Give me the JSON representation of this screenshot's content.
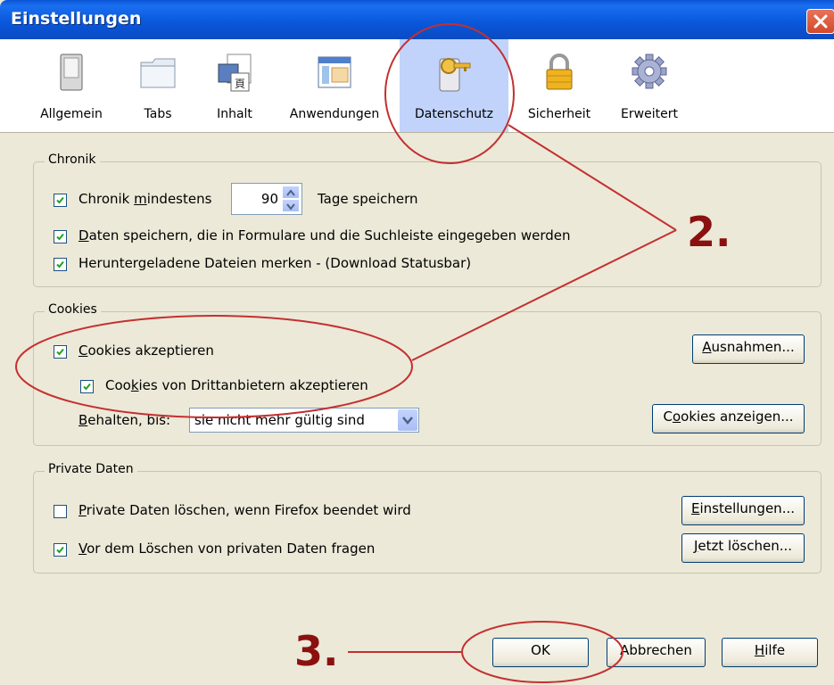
{
  "window": {
    "title": "Einstellungen"
  },
  "toolbar": {
    "items": [
      {
        "label": "Allgemein",
        "icon": "general-switch-icon"
      },
      {
        "label": "Tabs",
        "icon": "tabs-folder-icon"
      },
      {
        "label": "Inhalt",
        "icon": "content-page-icon"
      },
      {
        "label": "Anwendungen",
        "icon": "applications-window-icon"
      },
      {
        "label": "Datenschutz",
        "icon": "privacy-key-icon",
        "selected": true
      },
      {
        "label": "Sicherheit",
        "icon": "padlock-icon"
      },
      {
        "label": "Erweitert",
        "icon": "gear-icon"
      }
    ]
  },
  "history": {
    "legend": "Chronik",
    "keep_prefix": "Chronik ",
    "keep_access": "m",
    "keep_mid": "indestens",
    "days_value": "90",
    "days_suffix": "Tage speichern",
    "form_access": "D",
    "form_rest": "aten speichern, die in Formulare und die Suchleiste eingegeben werden",
    "downloads": "Heruntergeladene Dateien merken - (Download Statusbar)"
  },
  "cookies": {
    "legend": "Cookies",
    "accept_access": "C",
    "accept_rest": "ookies akzeptieren",
    "third_a": "Coo",
    "third_access": "k",
    "third_b": "ies von Drittanbietern akzeptieren",
    "keep_access": "B",
    "keep_rest": "ehalten, bis:",
    "keep_value": "sie nicht mehr gültig sind",
    "exceptions_access": "A",
    "exceptions_rest": "usnahmen...",
    "show_a": "C",
    "show_access": "o",
    "show_b": "okies anzeigen..."
  },
  "private": {
    "legend": "Private Daten",
    "clear_access": "P",
    "clear_rest": "rivate Daten löschen, wenn Firefox beendet wird",
    "ask_access": "V",
    "ask_rest": "or dem Löschen von privaten Daten fragen",
    "settings_access": "E",
    "settings_rest": "instellungen...",
    "clearnow_access": "J",
    "clearnow_rest": "etzt löschen..."
  },
  "buttons": {
    "ok": "OK",
    "cancel": "Abbrechen",
    "help_access": "H",
    "help_rest": "ilfe"
  },
  "annotations": {
    "step2": "2.",
    "step3": "3."
  },
  "colors": {
    "annotation": "#8b1010",
    "titlebar": "#0a55d6",
    "selected_tab": "#c1d3fb"
  }
}
